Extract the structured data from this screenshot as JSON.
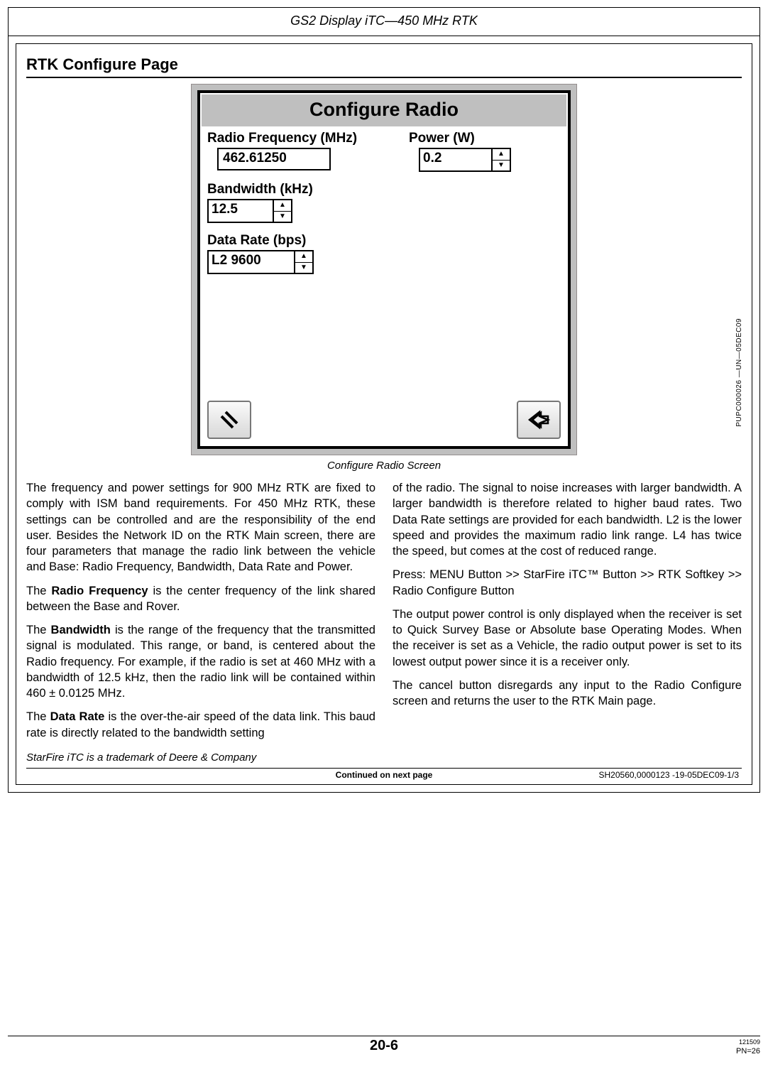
{
  "header": {
    "title": "GS2 Display iTC—450 MHz RTK"
  },
  "section": {
    "title": "RTK Configure Page"
  },
  "sidecode": "PUPC000026 —UN—05DEC09",
  "radio": {
    "title": "Configure Radio",
    "freq_label": "Radio Frequency (MHz)",
    "freq_value": "462.61250",
    "power_label": "Power (W)",
    "power_value": "0.2",
    "bw_label": "Bandwidth (kHz)",
    "bw_value": "12.5",
    "rate_label": "Data Rate (bps)",
    "rate_value": "L2 9600"
  },
  "caption": "Configure Radio Screen",
  "body": {
    "left": {
      "p1": "The frequency and power settings for 900 MHz RTK are fixed to comply with ISM band requirements. For 450 MHz RTK, these settings can be controlled and are the responsibility of the end user. Besides the Network ID on the RTK Main screen, there are four parameters that manage the radio link between the vehicle and Base: Radio Frequency, Bandwidth, Data Rate and Power.",
      "p2a": "The ",
      "p2b": "Radio Frequency",
      "p2c": " is the center frequency of the link shared between the Base and Rover.",
      "p3a": "The ",
      "p3b": "Bandwidth",
      "p3c": " is the range of the frequency that the transmitted signal is modulated. This range, or band, is centered about the Radio frequency. For example, if the radio is set at 460 MHz with a bandwidth of 12.5 kHz, then the radio link will be contained within 460 ± 0.0125 MHz.",
      "p4a": "The ",
      "p4b": "Data Rate",
      "p4c": " is the over-the-air speed of the data link. This baud rate is directly related to the bandwidth setting"
    },
    "right": {
      "p1": "of the radio. The signal to noise increases with larger bandwidth. A larger bandwidth is therefore related to higher baud rates. Two Data Rate settings are provided for each bandwidth. L2 is the lower speed and provides the maximum radio link range. L4 has twice the speed, but comes at the cost of reduced range.",
      "p2": "Press: MENU Button >> StarFire iTC™ Button >> RTK Softkey >> Radio Configure Button",
      "p3": "The output power control is only displayed when the receiver is set to Quick Survey Base or Absolute base Operating Modes. When the receiver is set as a Vehicle, the radio output power is set to its lowest output power since it is a receiver only.",
      "p4": "The cancel button disregards any input to the Radio Configure screen and returns the user to the RTK Main page."
    }
  },
  "trademark": "StarFire iTC is a trademark of Deere & Company",
  "continued": {
    "center": "Continued on next page",
    "right": "SH20560,0000123 -19-05DEC09-1/3"
  },
  "page_footer": {
    "center": "20-6",
    "right1": "121509",
    "right2": "PN=26"
  }
}
